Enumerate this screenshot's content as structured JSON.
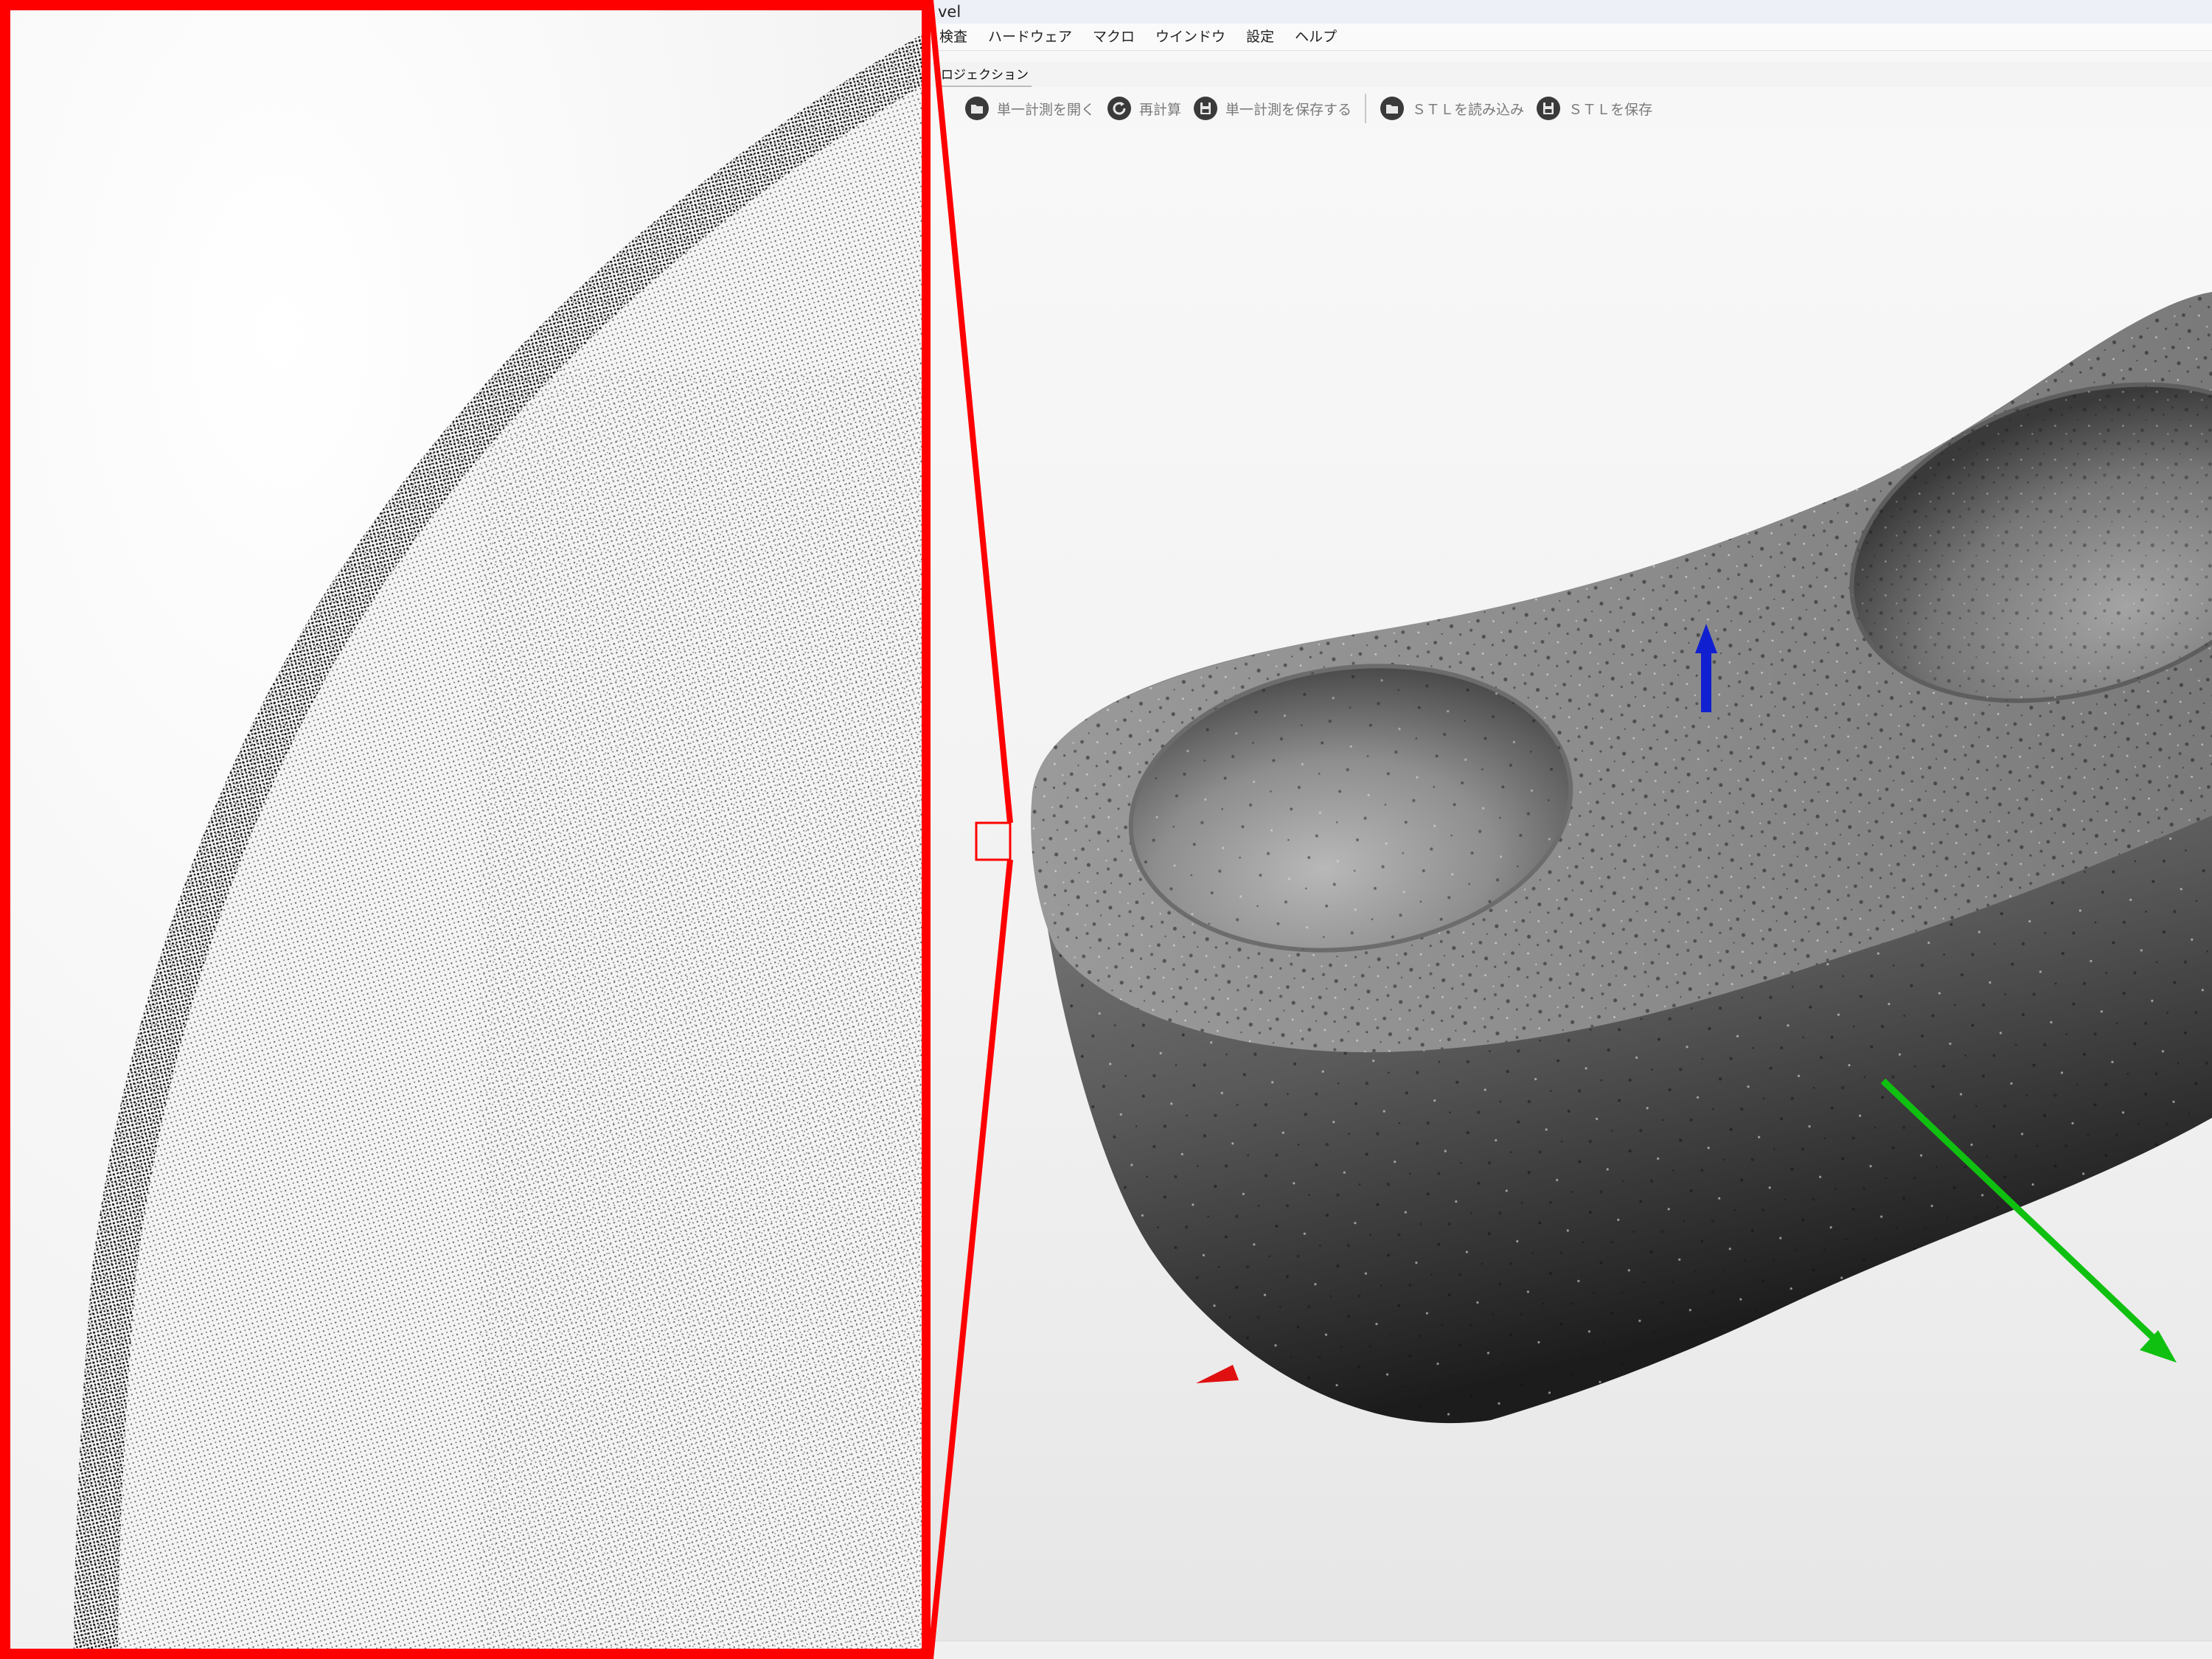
{
  "window": {
    "title": "vel"
  },
  "menu": {
    "items": [
      {
        "label": "検査"
      },
      {
        "label": "ハードウェア"
      },
      {
        "label": "マクロ"
      },
      {
        "label": "ウインドウ"
      },
      {
        "label": "設定"
      },
      {
        "label": "ヘルプ"
      }
    ]
  },
  "panel": {
    "tab_label": "ロジェクション"
  },
  "toolbar": {
    "buttons": [
      {
        "label": "単一計測を開く",
        "icon": "open-folder-icon"
      },
      {
        "label": "再計算",
        "icon": "recalculate-icon"
      },
      {
        "label": "単一計測を保存する",
        "icon": "save-disk-icon"
      },
      {
        "label": "ＳＴＬを読み込み",
        "icon": "open-folder-icon"
      },
      {
        "label": "ＳＴＬを保存",
        "icon": "save-disk-icon"
      }
    ]
  },
  "viewport": {
    "model": "two-cavity tray point cloud scan",
    "axes": {
      "x_color": "#e01010",
      "y_color": "#10c010",
      "z_color": "#1020d0"
    }
  },
  "zoom_inset": {
    "frame_color": "#ff0000"
  }
}
